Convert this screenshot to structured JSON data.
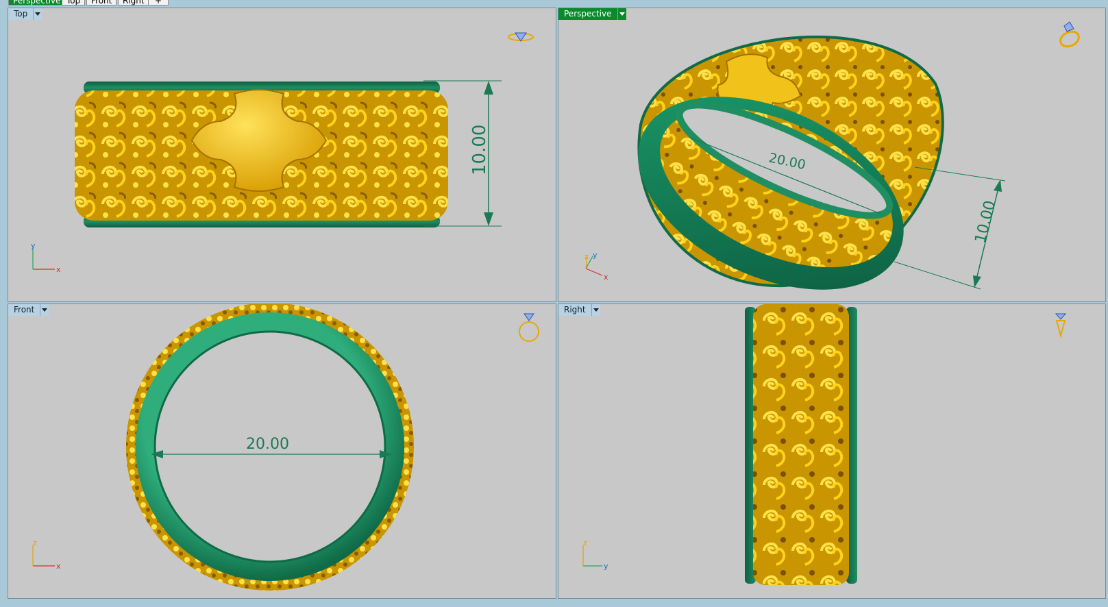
{
  "tabs": [
    {
      "label": "Perspective",
      "active": true
    },
    {
      "label": "Top",
      "active": false
    },
    {
      "label": "Front",
      "active": false
    },
    {
      "label": "Right",
      "active": false
    }
  ],
  "new_tab_glyph": "+",
  "viewports": {
    "top": {
      "label": "Top",
      "dimension": "10.00",
      "axis_h": "x",
      "axis_v": "y",
      "view_icon": "ring-top-view-icon"
    },
    "perspective": {
      "label": "Perspective",
      "dimension_diameter": "20.00",
      "dimension_width": "10.00",
      "axis_h": "x",
      "axis_v": "y",
      "axis_z": "z",
      "view_icon": "ring-perspective-view-icon"
    },
    "front": {
      "label": "Front",
      "dimension": "20.00",
      "axis_h": "x",
      "axis_v": "z",
      "view_icon": "ring-front-view-icon"
    },
    "right": {
      "label": "Right",
      "axis_h": "y",
      "axis_v": "z",
      "view_icon": "ring-side-view-icon"
    }
  },
  "colors": {
    "viewport_bg": "#c8c8c8",
    "active_label": "#0a8a2a",
    "label_bg": "#b9d2e3",
    "gold": "#e8b400",
    "gold_dark": "#9a6d00",
    "green": "#1f8f63",
    "dimension": "#1a7a55"
  }
}
